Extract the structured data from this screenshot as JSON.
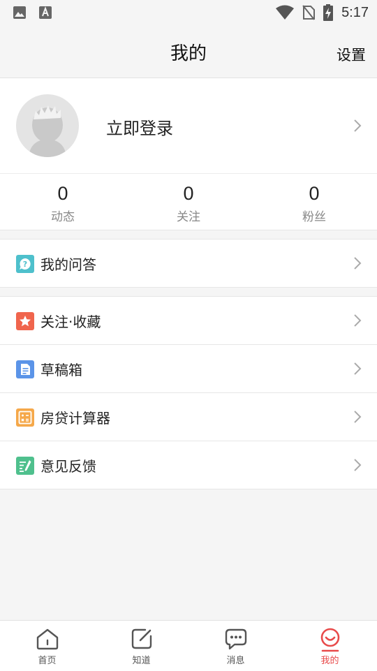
{
  "status_bar": {
    "time": "5:17",
    "left_icons": [
      "image-icon",
      "font-icon"
    ],
    "right_icons": [
      "wifi-icon",
      "no-sim-icon",
      "battery-charging-icon"
    ]
  },
  "header": {
    "title": "我的",
    "settings_label": "设置"
  },
  "profile": {
    "login_label": "立即登录"
  },
  "stats": [
    {
      "value": "0",
      "label": "动态"
    },
    {
      "value": "0",
      "label": "关注"
    },
    {
      "value": "0",
      "label": "粉丝"
    }
  ],
  "menu_group_1": [
    {
      "label": "我的问答",
      "icon": "question-icon",
      "color": "#4ec0cc"
    }
  ],
  "menu_group_2": [
    {
      "label": "关注·收藏",
      "icon": "star-icon",
      "color": "#f0654d"
    },
    {
      "label": "草稿箱",
      "icon": "document-icon",
      "color": "#5b94e8"
    },
    {
      "label": "房贷计算器",
      "icon": "calculator-icon",
      "color": "#f5a84a"
    },
    {
      "label": "意见反馈",
      "icon": "feedback-icon",
      "color": "#4fc08d"
    }
  ],
  "tabbar": {
    "tabs": [
      {
        "label": "首页",
        "icon": "home-icon",
        "active": false
      },
      {
        "label": "知道",
        "icon": "edit-icon",
        "active": false
      },
      {
        "label": "消息",
        "icon": "message-icon",
        "active": false
      },
      {
        "label": "我的",
        "icon": "smile-icon",
        "active": true
      }
    ],
    "active_color": "#e84a4a",
    "inactive_color": "#555555"
  }
}
